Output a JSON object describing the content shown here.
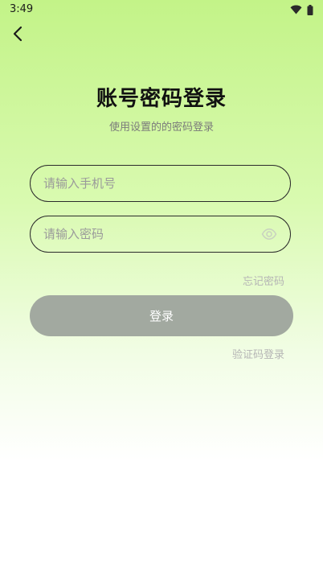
{
  "status_bar": {
    "time": "3:49",
    "icons": [
      "wifi-icon",
      "battery-icon"
    ]
  },
  "nav": {
    "back_icon": "chevron-left-icon"
  },
  "header": {
    "title": "账号密码登录",
    "subtitle": "使用设置的的密码登录"
  },
  "form": {
    "phone_placeholder": "请输入手机号",
    "password_placeholder": "请输入密码",
    "password_toggle_icon": "eye-icon",
    "forgot_password": "忘记密码",
    "submit_label": "登录",
    "sms_login": "验证码登录"
  },
  "colors": {
    "background_top": "#c3f388",
    "background_bottom": "#ffffff",
    "button_bg": "#a2a9a0",
    "link_text": "#b5b5b5"
  }
}
